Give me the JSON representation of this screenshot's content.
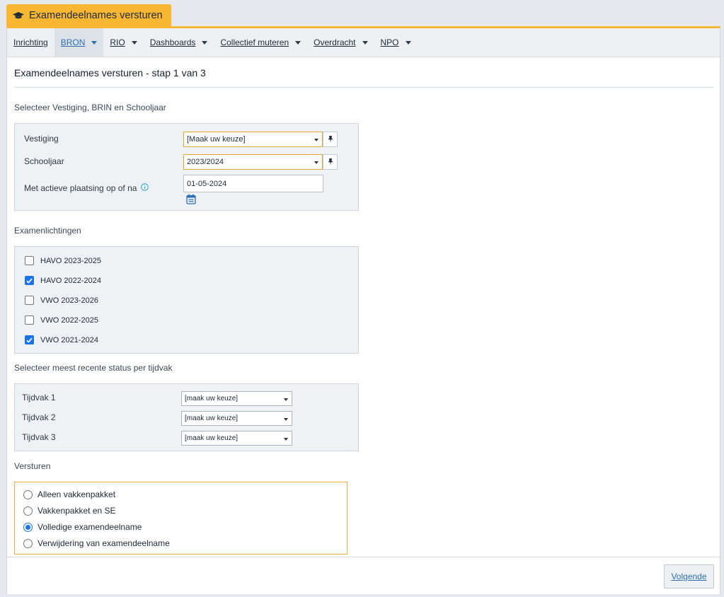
{
  "window_tab": {
    "title": "Examendeelnames versturen",
    "icon": "graduation-cap-icon",
    "color": "#f7b733"
  },
  "menu": [
    {
      "label": "Inrichting",
      "dropdown": false,
      "active": false
    },
    {
      "label": "BRON",
      "dropdown": true,
      "active": true
    },
    {
      "label": "RIO",
      "dropdown": true,
      "active": false
    },
    {
      "label": "Dashboards",
      "dropdown": true,
      "active": false
    },
    {
      "label": "Collectief muteren",
      "dropdown": true,
      "active": false
    },
    {
      "label": "Overdracht",
      "dropdown": true,
      "active": false
    },
    {
      "label": "NPO",
      "dropdown": true,
      "active": false
    }
  ],
  "page_title": "Examendeelnames versturen - stap 1 van 3",
  "selection": {
    "heading": "Selecteer Vestiging, BRIN en Schooljaar",
    "vestiging_label": "Vestiging",
    "vestiging_value": "[Maak uw keuze]",
    "schooljaar_label": "Schooljaar",
    "schooljaar_value": "2023/2024",
    "plaatsing_label": "Met actieve plaatsing op of na",
    "plaatsing_value": "01-05-2024"
  },
  "examenlichtingen": {
    "heading": "Examenlichtingen",
    "items": [
      {
        "label": "HAVO 2023-2025",
        "checked": false
      },
      {
        "label": "HAVO 2022-2024",
        "checked": true
      },
      {
        "label": "VWO 2023-2026",
        "checked": false
      },
      {
        "label": "VWO 2022-2025",
        "checked": false
      },
      {
        "label": "VWO 2021-2024",
        "checked": true
      }
    ]
  },
  "tijdvak": {
    "heading": "Selecteer meest recente status per tijdvak",
    "rows": [
      {
        "label": "Tijdvak 1",
        "value": "[maak uw keuze]"
      },
      {
        "label": "Tijdvak 2",
        "value": "[maak uw keuze]"
      },
      {
        "label": "Tijdvak 3",
        "value": "[maak uw keuze]"
      }
    ]
  },
  "versturen": {
    "heading": "Versturen",
    "options": [
      {
        "label": "Alleen vakkenpakket",
        "selected": false
      },
      {
        "label": "Vakkenpakket en SE",
        "selected": false
      },
      {
        "label": "Volledige examendeelname",
        "selected": true
      },
      {
        "label": "Verwijdering van examendeelname",
        "selected": false
      }
    ]
  },
  "footer": {
    "next_label": "Volgende"
  },
  "colors": {
    "accent": "#f7b733",
    "link": "#2c6fb3",
    "check": "#1a73e8"
  }
}
